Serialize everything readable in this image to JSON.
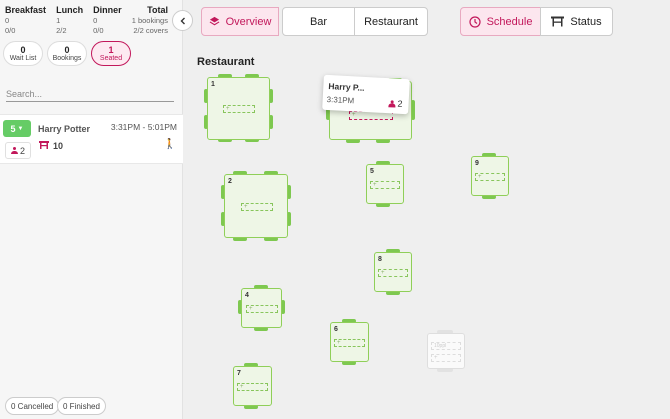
{
  "summary": {
    "breakfast": {
      "label": "Breakfast",
      "bookings": "0",
      "covers": "0/0"
    },
    "lunch": {
      "label": "Lunch",
      "bookings": "1",
      "covers": "2/2"
    },
    "dinner": {
      "label": "Dinner",
      "bookings": "0",
      "covers": "0/0"
    },
    "total": {
      "label": "Total",
      "bookings": "1 bookings",
      "covers": "2/2 covers"
    }
  },
  "pills": {
    "waitlist": {
      "count": "0",
      "label": "Wait List"
    },
    "bookings": {
      "count": "0",
      "label": "Bookings"
    },
    "seated": {
      "count": "1",
      "label": "Seated"
    }
  },
  "search": {
    "placeholder": "Search..."
  },
  "booking": {
    "party_size": "5",
    "covers": "2",
    "name": "Harry Potter",
    "time": "3:31PM - 5:01PM",
    "table": "10"
  },
  "footer": {
    "cancelled": "0 Cancelled",
    "finished": "0 Finished"
  },
  "nav": {
    "overview": "Overview",
    "bar": "Bar",
    "restaurant": "Restaurant",
    "schedule": "Schedule",
    "status": "Status"
  },
  "floor": {
    "title": "Restaurant",
    "tables": {
      "t1": "1",
      "t2": "2",
      "t4": "4",
      "t5": "5",
      "t6": "6",
      "t7": "7",
      "t8": "8",
      "t9": "9"
    },
    "slot_plus": "+",
    "ghost_text": "10ppl"
  },
  "drag": {
    "name": "Harry P...",
    "time": "3:31PM",
    "covers": "2"
  },
  "colors": {
    "accent": "#c2185b",
    "table_green": "#8fcf58",
    "badge_green": "#66cc66"
  }
}
